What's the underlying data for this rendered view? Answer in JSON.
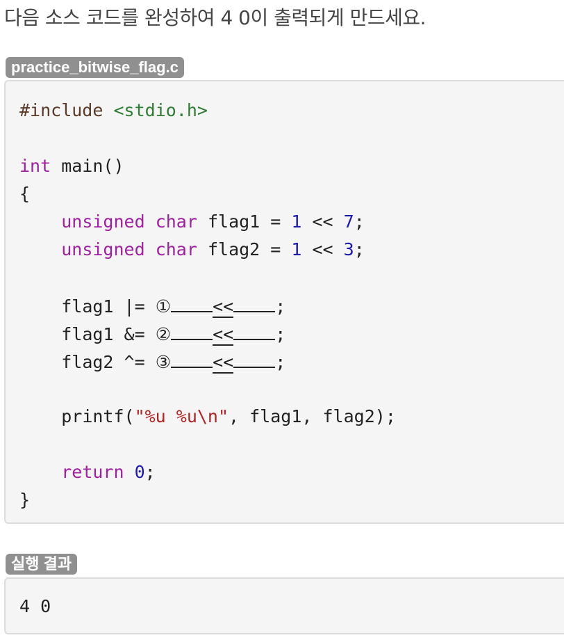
{
  "instruction": "다음 소스 코드를 완성하여 4 0이 출력되게 만드세요.",
  "file_tag": "practice_bitwise_flag.c",
  "code": {
    "include_directive": "#include",
    "include_header": "<stdio.h>",
    "main_type": "int",
    "main_sig": " main()",
    "open_brace": "{",
    "decl1": {
      "type1": "unsigned",
      "type2": "char",
      "rest": " flag1 = ",
      "n1": "1",
      "op": " << ",
      "n2": "7",
      "end": ";"
    },
    "decl2": {
      "type1": "unsigned",
      "type2": "char",
      "rest": " flag2 = ",
      "n1": "1",
      "op": " << ",
      "n2": "3",
      "end": ";"
    },
    "blank1": {
      "prefix": "flag1 |= ",
      "marker": "①",
      "op": "<<",
      "end": ";"
    },
    "blank2": {
      "prefix": "flag1 &= ",
      "marker": "②",
      "op": "<<",
      "end": ";"
    },
    "blank3": {
      "prefix": "flag2 ^= ",
      "marker": "③",
      "op": "<<",
      "end": ";"
    },
    "printf_fn": "printf(",
    "printf_fmt": "\"%u %u\\n\"",
    "printf_args": ", flag1, flag2);",
    "return_kw": "return",
    "return_val": "0",
    "return_end": ";",
    "close_brace": "}"
  },
  "result_tag": "실행 결과",
  "output": "4 0"
}
